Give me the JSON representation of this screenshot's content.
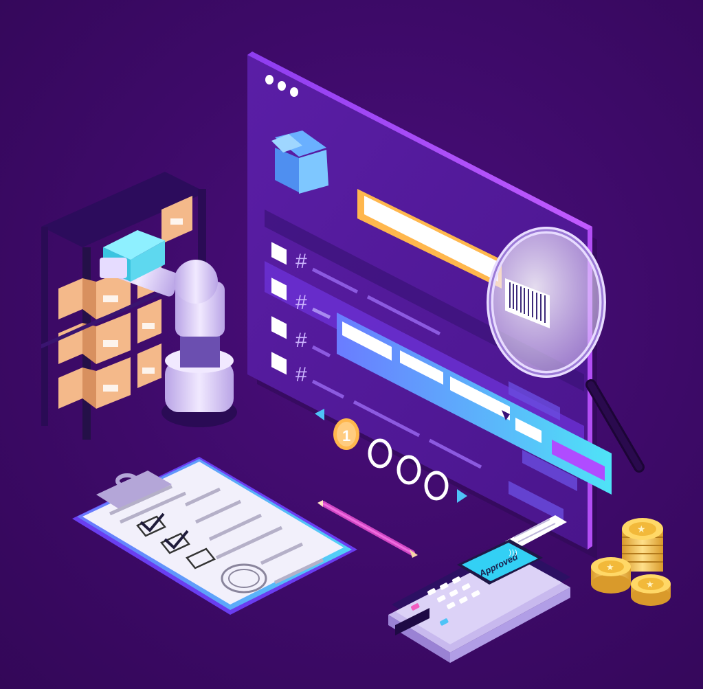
{
  "illustration": {
    "colors": {
      "background": "#3d0a68",
      "panel": "#5b1fa8",
      "panel_edge": "#7a2fd0",
      "accent_cyan": "#4fc3f7",
      "accent_orange": "#ffb74d",
      "box": "#f4b98a",
      "coin": "#f2c14e"
    },
    "window": {
      "search_bar": {
        "value": ""
      },
      "rows": [
        {
          "symbol": "#",
          "checked": false,
          "highlighted": false
        },
        {
          "symbol": "#",
          "checked": false,
          "highlighted": true
        },
        {
          "symbol": "#",
          "checked": false,
          "highlighted": false
        },
        {
          "symbol": "#",
          "checked": false,
          "highlighted": false
        }
      ],
      "pagination": {
        "current_page": "1",
        "total_dots": 4
      }
    },
    "terminal": {
      "screen_text": "Approved",
      "icon": "contactless-icon"
    },
    "clipboard": {
      "checklist": [
        true,
        true,
        false
      ]
    },
    "icons": [
      "box-logo-icon",
      "magnifier-icon",
      "barcode-icon",
      "robot-arm-icon",
      "shelf-icon",
      "pencil-icon",
      "coin-stack-icon",
      "stamp-icon"
    ]
  }
}
